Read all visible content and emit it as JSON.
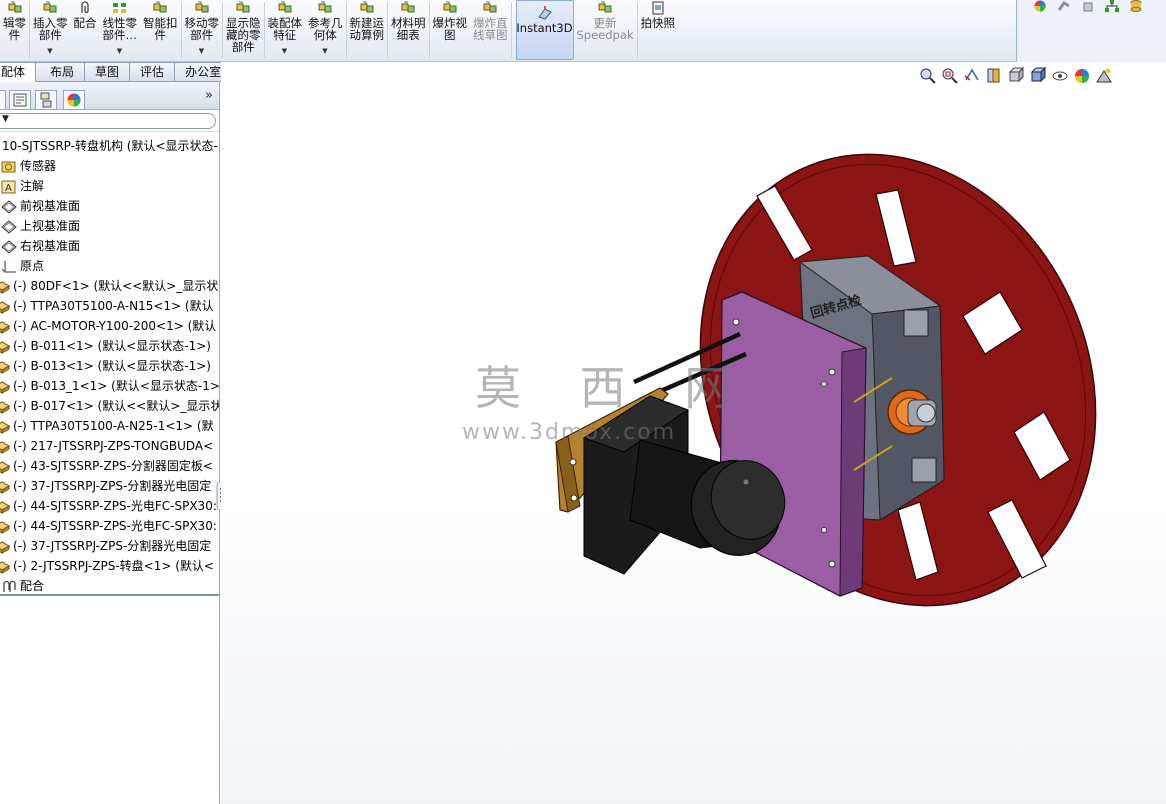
{
  "ribbon": {
    "tools": [
      {
        "id": "edit-component",
        "label": "辑零\n件",
        "icon": "edit-component-icon"
      },
      {
        "id": "insert-components",
        "label": "插入零\n部件",
        "icon": "insert-component-icon",
        "dropdown": true
      },
      {
        "id": "mate",
        "label": "配合",
        "icon": "paperclip-mate-icon"
      },
      {
        "id": "linear-pattern",
        "label": "线性零\n部件…",
        "icon": "linear-pattern-icon",
        "dropdown": true
      },
      {
        "id": "smart-fasteners",
        "label": "智能扣\n件",
        "icon": "smart-fastener-icon"
      },
      {
        "id": "move-component",
        "label": "移动零\n部件",
        "icon": "move-component-icon",
        "dropdown": true
      },
      {
        "id": "show-hidden",
        "label": "显示隐\n藏的零\n部件",
        "icon": "show-hidden-icon"
      },
      {
        "id": "assembly-features",
        "label": "装配体\n特征",
        "icon": "assembly-feature-icon",
        "dropdown": true
      },
      {
        "id": "reference-geometry",
        "label": "参考几\n何体",
        "icon": "reference-geometry-icon",
        "dropdown": true
      },
      {
        "id": "new-motion-study",
        "label": "新建运\n动算例",
        "icon": "motion-study-icon"
      },
      {
        "id": "bom",
        "label": "材料明\n细表",
        "icon": "bom-icon"
      },
      {
        "id": "exploded-view",
        "label": "爆炸视\n图",
        "icon": "exploded-view-icon"
      },
      {
        "id": "explode-line-sketch",
        "label": "爆炸直\n线草图",
        "icon": "explode-line-icon",
        "disabled": true
      },
      {
        "id": "instant3d",
        "label": "Instant3D",
        "icon": "instant3d-icon",
        "selected": true
      },
      {
        "id": "update-speedpak",
        "label": "更新\nSpeedpak",
        "icon": "speedpak-icon",
        "disabled": true
      },
      {
        "id": "snapshot",
        "label": "拍快照",
        "icon": "snapshot-icon"
      }
    ]
  },
  "tabs": [
    "配体",
    "布局",
    "草图",
    "评估",
    "办公室产品"
  ],
  "active_tab": 0,
  "panel": {
    "tabs": [
      "feature-manager-icon",
      "property-manager-icon",
      "configuration-manager-icon",
      "display-manager-icon"
    ],
    "root": "10-SJTSSRP-转盘机构 (默认<显示状态-",
    "items": [
      {
        "text": "传感器",
        "icon": "sensor-icon"
      },
      {
        "text": "注解",
        "icon": "annotation-icon"
      },
      {
        "text": "前视基准面",
        "icon": "plane-icon"
      },
      {
        "text": "上视基准面",
        "icon": "plane-icon"
      },
      {
        "text": "右视基准面",
        "icon": "plane-icon"
      },
      {
        "text": "原点",
        "icon": "origin-icon"
      },
      {
        "text": "(-) 80DF<1> (默认<<默认>_显示状",
        "icon": "part-icon"
      },
      {
        "text": "(-) TTPA30T5100-A-N15<1> (默认",
        "icon": "part-icon"
      },
      {
        "text": "(-) AC-MOTOR-Y100-200<1> (默认",
        "icon": "part-icon"
      },
      {
        "text": "(-) B-011<1> (默认<显示状态-1>)",
        "icon": "part-icon"
      },
      {
        "text": "(-) B-013<1> (默认<显示状态-1>)",
        "icon": "part-icon"
      },
      {
        "text": "(-) B-013_1<1> (默认<显示状态-1>",
        "icon": "part-icon"
      },
      {
        "text": "(-) B-017<1> (默认<<默认>_显示状",
        "icon": "part-icon"
      },
      {
        "text": "(-) TTPA30T5100-A-N25-1<1> (默",
        "icon": "part-icon"
      },
      {
        "text": "(-) 217-JTSSRPJ-ZPS-TONGBUDA<",
        "icon": "part-icon"
      },
      {
        "text": "(-) 43-SJTSSRP-ZPS-分割器固定板<",
        "icon": "part-icon"
      },
      {
        "text": "(-) 37-JTSSRPJ-ZPS-分割器光电固定",
        "icon": "part-icon"
      },
      {
        "text": "(-) 44-SJTSSRP-ZPS-光电FC-SPX30:",
        "icon": "part-icon"
      },
      {
        "text": "(-) 44-SJTSSRP-ZPS-光电FC-SPX30:",
        "icon": "part-icon"
      },
      {
        "text": "(-) 37-JTSSRPJ-ZPS-分割器光电固定",
        "icon": "part-icon"
      },
      {
        "text": "(-) 2-JTSSRPJ-ZPS-转盘<1> (默认<",
        "icon": "part-icon"
      },
      {
        "text": "配合",
        "icon": "mates-icon"
      }
    ]
  },
  "viewport": {
    "heads_up": [
      "zoom-to-fit-icon",
      "zoom-to-area-icon",
      "previous-view-icon",
      "section-view-icon",
      "view-orientation-icon",
      "display-style-icon",
      "hide-show-icon",
      "edit-appearance-icon",
      "apply-scene-icon"
    ],
    "watermark_cn": "莫 西 网",
    "watermark_url": "www.3dmox.com",
    "model_label": "回转点检",
    "colors": {
      "disc": "#8b1414",
      "plate": "#9a5fa3",
      "gearbox": "#6c7280",
      "motor": "#1b1b1b",
      "bracket": "#b5832f",
      "hub": "#e06a1a"
    }
  }
}
